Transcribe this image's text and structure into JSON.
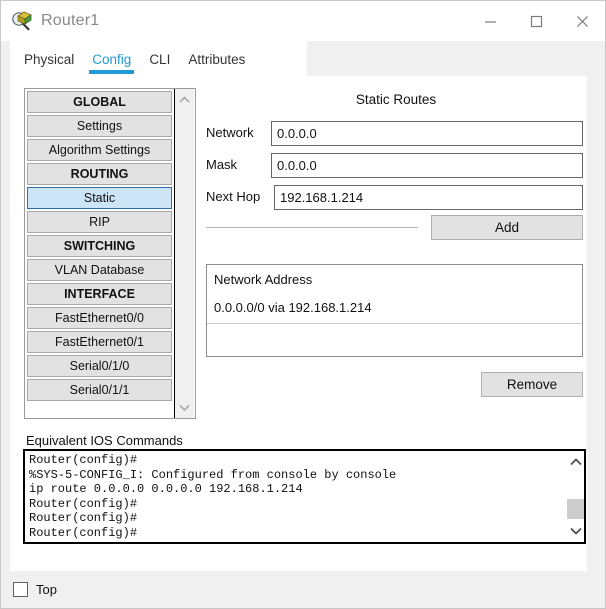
{
  "window": {
    "title": "Router1",
    "icon": "router-inspect-icon",
    "minimize_label": "—",
    "maximize_label": "□",
    "close_label": "✕"
  },
  "tabs": [
    {
      "label": "Physical",
      "active": false
    },
    {
      "label": "Config",
      "active": true
    },
    {
      "label": "CLI",
      "active": false
    },
    {
      "label": "Attributes",
      "active": false
    }
  ],
  "sidebar": {
    "items": [
      {
        "label": "GLOBAL",
        "type": "header",
        "selected": false
      },
      {
        "label": "Settings",
        "type": "item",
        "selected": false
      },
      {
        "label": "Algorithm Settings",
        "type": "item",
        "selected": false
      },
      {
        "label": "ROUTING",
        "type": "header",
        "selected": false
      },
      {
        "label": "Static",
        "type": "item",
        "selected": true
      },
      {
        "label": "RIP",
        "type": "item",
        "selected": false
      },
      {
        "label": "SWITCHING",
        "type": "header",
        "selected": false
      },
      {
        "label": "VLAN Database",
        "type": "item",
        "selected": false
      },
      {
        "label": "INTERFACE",
        "type": "header",
        "selected": false
      },
      {
        "label": "FastEthernet0/0",
        "type": "item",
        "selected": false
      },
      {
        "label": "FastEthernet0/1",
        "type": "item",
        "selected": false
      },
      {
        "label": "Serial0/1/0",
        "type": "item",
        "selected": false
      },
      {
        "label": "Serial0/1/1",
        "type": "item",
        "selected": false
      }
    ],
    "scroll_up": "⌃",
    "scroll_down": "⌄"
  },
  "static_routes": {
    "title": "Static Routes",
    "network_label": "Network",
    "network_value": "0.0.0.0",
    "network_placeholder": "",
    "mask_label": "Mask",
    "mask_value": "0.0.0.0",
    "mask_placeholder": "",
    "nexthop_label": "Next Hop",
    "nexthop_value": "192.168.1.214",
    "nexthop_placeholder": "",
    "add_label": "Add",
    "remove_label": "Remove",
    "list_header": "Network Address",
    "entries": [
      "0.0.0.0/0 via 192.168.1.214"
    ]
  },
  "ios": {
    "label": "Equivalent IOS Commands",
    "text": "Router(config)#\n%SYS-5-CONFIG_I: Configured from console by console\nip route 0.0.0.0 0.0.0.0 192.168.1.214\nRouter(config)#\nRouter(config)#\nRouter(config)#",
    "scroll_up": "⌃",
    "scroll_down": "⌄"
  },
  "bottom": {
    "top_label": "Top",
    "top_checked": false
  },
  "colors": {
    "accent": "#1e9bd7",
    "selection": "#cde5f7",
    "selection_border": "#2f6ea8",
    "button_face": "#e2e2e2",
    "window_bg": "#f0f0f0"
  }
}
